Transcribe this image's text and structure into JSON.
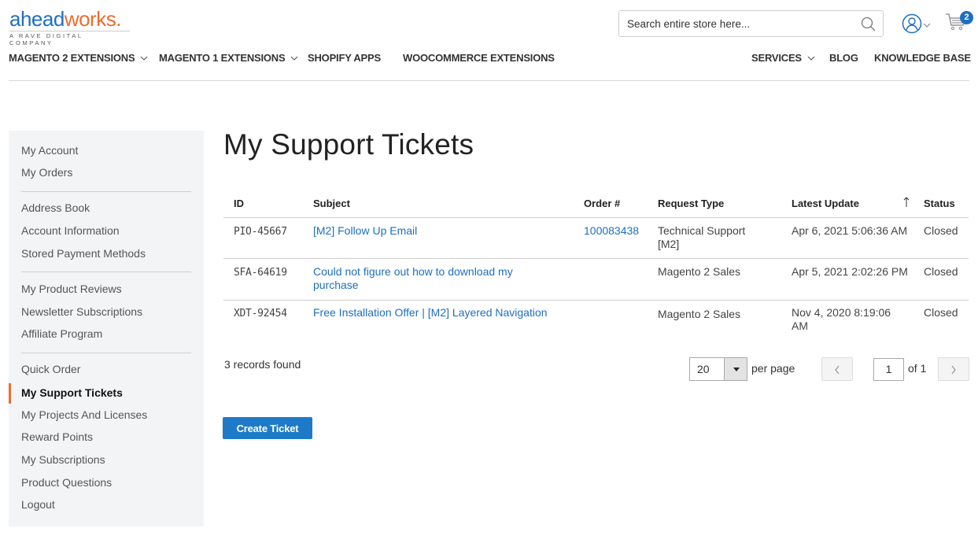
{
  "brand": {
    "logo_part1": "ahead",
    "logo_part2": "works.",
    "tagline": "A RAVE DIGITAL COMPANY",
    "primary_color": "#1e6fc1",
    "accent_color": "#ee6b2f"
  },
  "header": {
    "search_placeholder": "Search entire store here...",
    "search_icon": "search-icon",
    "account_icon": "user-circle-icon",
    "cart_icon": "shopping-cart-icon",
    "cart_count": "2"
  },
  "topnav": {
    "left": [
      {
        "label": "MAGENTO 2 EXTENSIONS",
        "has_dropdown": true
      },
      {
        "label": "MAGENTO 1 EXTENSIONS",
        "has_dropdown": true
      },
      {
        "label": "SHOPIFY APPS",
        "has_dropdown": false
      },
      {
        "label": "WOOCOMMERCE EXTENSIONS",
        "has_dropdown": false
      }
    ],
    "right": [
      {
        "label": "SERVICES",
        "has_dropdown": true
      },
      {
        "label": "BLOG",
        "has_dropdown": false
      },
      {
        "label": "KNOWLEDGE BASE",
        "has_dropdown": false
      }
    ]
  },
  "sidebar": {
    "groups": [
      [
        {
          "label": "My Account"
        },
        {
          "label": "My Orders"
        }
      ],
      [
        {
          "label": "Address Book"
        },
        {
          "label": "Account Information"
        },
        {
          "label": "Stored Payment Methods"
        }
      ],
      [
        {
          "label": "My Product Reviews"
        },
        {
          "label": "Newsletter Subscriptions"
        },
        {
          "label": "Affiliate Program"
        }
      ],
      [
        {
          "label": "Quick Order"
        },
        {
          "label": "My Support Tickets",
          "active": true
        },
        {
          "label": "My Projects And Licenses"
        },
        {
          "label": "Reward Points"
        },
        {
          "label": "My Subscriptions"
        },
        {
          "label": "Product Questions"
        },
        {
          "label": "Logout"
        }
      ]
    ]
  },
  "main": {
    "title": "My Support Tickets",
    "table": {
      "columns": [
        "ID",
        "Subject",
        "Order #",
        "Request Type",
        "Latest Update",
        "Status"
      ],
      "sorted_column": "Latest Update",
      "sort_direction": "ascending",
      "rows": [
        {
          "id": "PIO-45667",
          "subject": "[M2] Follow Up Email",
          "order": "100083438",
          "request_type": "Technical Support [M2]",
          "latest_update": "Apr 6, 2021 5:06:36 AM",
          "status": "Closed"
        },
        {
          "id": "SFA-64619",
          "subject": "Could not figure out how to download my purchase",
          "order": "",
          "request_type": "Magento 2 Sales",
          "latest_update": "Apr 5, 2021 2:02:26 PM",
          "status": "Closed"
        },
        {
          "id": "XDT-92454",
          "subject": "Free Installation Offer | [M2] Layered Navigation",
          "order": "",
          "request_type": "Magento 2 Sales",
          "latest_update": "Nov 4, 2020 8:19:06 AM",
          "status": "Closed"
        }
      ]
    },
    "records_found": "3 records found",
    "pager": {
      "per_page_value": "20",
      "per_page_label": "per page",
      "current_page": "1",
      "of_label": "of 1",
      "prev_icon": "chevron-left-icon",
      "next_icon": "chevron-right-icon"
    },
    "create_button": "Create Ticket"
  }
}
